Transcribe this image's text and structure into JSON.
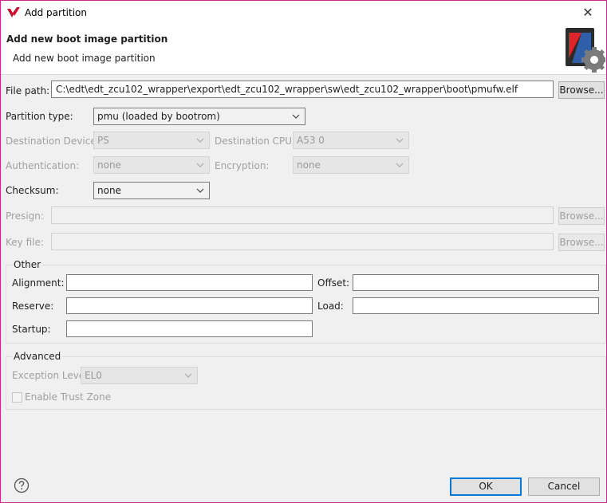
{
  "window": {
    "title": "Add partition",
    "close_glyph": "✕"
  },
  "header": {
    "title": "Add new boot image partition",
    "subtitle": "Add new boot image partition"
  },
  "file_path": {
    "label": "File path:",
    "value": "C:\\edt\\edt_zcu102_wrapper\\export\\edt_zcu102_wrapper\\sw\\edt_zcu102_wrapper\\boot\\pmufw.elf",
    "browse": "Browse..."
  },
  "partition_type": {
    "label": "Partition type:",
    "value": "pmu (loaded by bootrom)"
  },
  "destination_device": {
    "label": "Destination Device:",
    "value": "PS"
  },
  "destination_cpu": {
    "label": "Destination CPU:",
    "value": "A53 0"
  },
  "authentication": {
    "label": "Authentication:",
    "value": "none"
  },
  "encryption": {
    "label": "Encryption:",
    "value": "none"
  },
  "checksum": {
    "label": "Checksum:",
    "value": "none"
  },
  "presign": {
    "label": "Presign:",
    "value": "",
    "browse": "Browse..."
  },
  "key_file": {
    "label": "Key file:",
    "value": "",
    "browse": "Browse..."
  },
  "other": {
    "title": "Other",
    "alignment": {
      "label": "Alignment:",
      "value": ""
    },
    "offset": {
      "label": "Offset:",
      "value": ""
    },
    "reserve": {
      "label": "Reserve:",
      "value": ""
    },
    "load": {
      "label": "Load:",
      "value": ""
    },
    "startup": {
      "label": "Startup:",
      "value": ""
    }
  },
  "advanced": {
    "title": "Advanced",
    "exception_level": {
      "label": "Exception Level",
      "value": "EL0"
    },
    "trust_zone": {
      "label": "Enable Trust Zone",
      "checked": false
    }
  },
  "footer": {
    "ok": "OK",
    "cancel": "Cancel",
    "help_icon": "question-circle-icon"
  },
  "colors": {
    "window_border": "#c42b8e",
    "primary_border": "#0078d7",
    "logo_red": "#c8102e"
  }
}
